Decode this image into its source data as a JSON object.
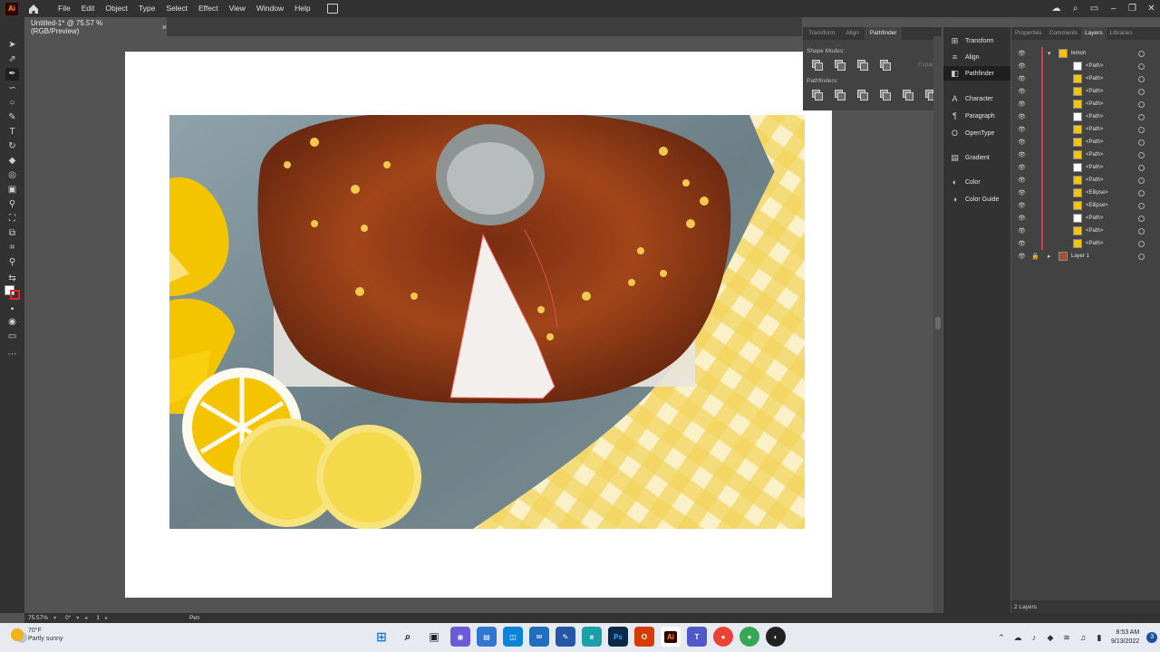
{
  "menubar": {
    "app_logo": "Ai",
    "items": [
      "File",
      "Edit",
      "Object",
      "Type",
      "Select",
      "Effect",
      "View",
      "Window",
      "Help"
    ]
  },
  "doc_tab": {
    "title": "Untitled-1* @ 75.57 % (RGB/Preview)",
    "close": "×"
  },
  "pathfinder": {
    "tabs": [
      "Transform",
      "Align",
      "Pathfinder"
    ],
    "shape_modes_label": "Shape Modes:",
    "pathfinders_label": "Pathfinders:",
    "expand_label": "Expand"
  },
  "panels": [
    "Transform",
    "Align",
    "Pathfinder",
    "Character",
    "Paragraph",
    "OpenType",
    "Gradient",
    "Color",
    "Color Guide"
  ],
  "layers": {
    "tabs": [
      "Properties",
      "Comments",
      "Layers",
      "Libraries"
    ],
    "group_name": "lemon",
    "items": [
      "<Path>",
      "<Path>",
      "<Path>",
      "<Path>",
      "<Path>",
      "<Path>",
      "<Path>",
      "<Path>",
      "<Path>",
      "<Path>",
      "<Ellipse>",
      "<Ellipse>",
      "<Path>",
      "<Path>",
      "<Path>"
    ],
    "layer_name": "Layer 1",
    "footer": "2 Layers"
  },
  "statusbar": {
    "zoom": "75.57%",
    "rotation": "0°",
    "artboard": "1",
    "tool": "Pen"
  },
  "taskbar": {
    "weather_temp": "70°F",
    "weather_desc": "Partly sunny",
    "time": "8:53 AM",
    "date": "9/13/2022",
    "notifications": "3"
  },
  "colors": {
    "accent": "#2d8ceb",
    "lemon": "#f5c400",
    "panel": "#424242"
  }
}
